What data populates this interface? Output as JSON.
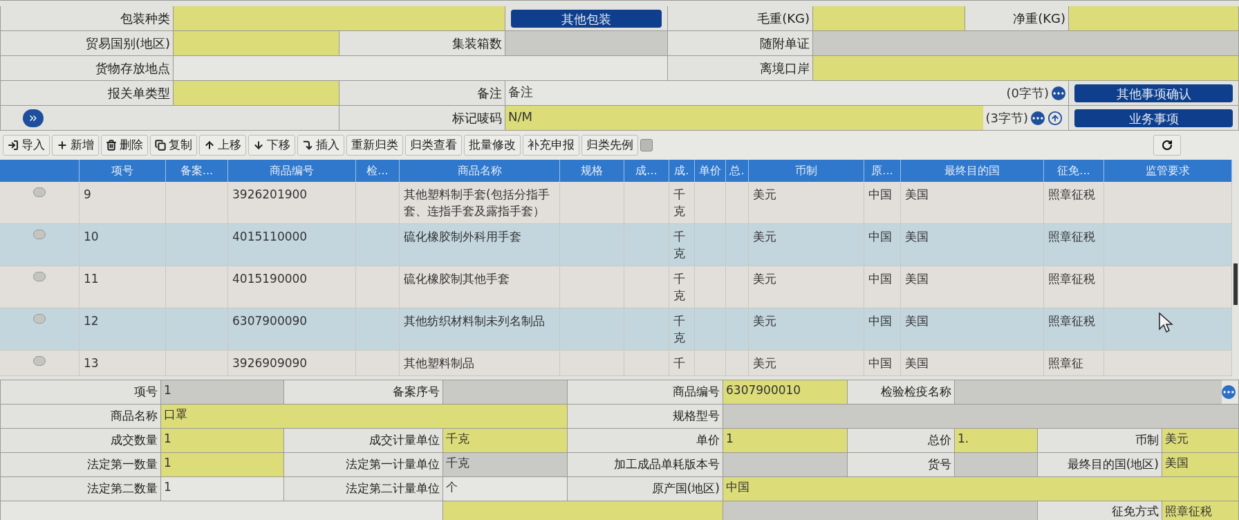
{
  "header_form": {
    "rows": [
      [
        {
          "label": "包装种类",
          "kind": "required_field"
        },
        {
          "kind": "button",
          "text": "其他包装"
        },
        {
          "label": "毛重(KG)",
          "kind": "required_field"
        },
        {
          "label": "净重(KG)",
          "kind": "required_field"
        }
      ],
      [
        {
          "label": "贸易国别(地区)",
          "kind": "required_field"
        },
        {
          "label": "集装箱数",
          "kind": "readonly_field"
        },
        {
          "label": "随附单证",
          "kind": "readonly_field"
        }
      ],
      [
        {
          "label": "货物存放地点",
          "kind": "field"
        },
        {
          "label": "离境口岸",
          "kind": "required_field"
        }
      ],
      [
        {
          "label": "报关单类型",
          "kind": "required_field"
        },
        {
          "label": "备注",
          "kind": "field",
          "value": "备注",
          "counter": "(0字节)"
        },
        {
          "kind": "button",
          "text": "其他事项确认"
        }
      ],
      [
        {
          "kind": "expand"
        },
        {
          "label": "标记唛码",
          "kind": "required_field",
          "value": "N/M",
          "counter": "(3字节)"
        },
        {
          "kind": "button",
          "text": "业务事项"
        }
      ]
    ]
  },
  "toolbar": {
    "buttons": [
      {
        "label": "导入"
      },
      {
        "label": "新增"
      },
      {
        "label": "删除"
      },
      {
        "label": "复制"
      },
      {
        "label": "上移"
      },
      {
        "label": "下移"
      },
      {
        "label": "插入"
      },
      {
        "label": "重新归类"
      },
      {
        "label": "归类查看"
      },
      {
        "label": "批量修改"
      },
      {
        "label": "补充申报"
      },
      {
        "label": "归类先例"
      }
    ],
    "toggle": {
      "checked": false
    }
  },
  "table": {
    "columns": [
      "项号",
      "备案...",
      "商品编号",
      "检...",
      "商品名称",
      "规格",
      "成...",
      "成.",
      "单价",
      "总.",
      "币制",
      "原...",
      "最终目的国",
      "征免...",
      "监管要求"
    ],
    "rows": [
      {
        "selected": false,
        "item_no": "9",
        "code": "3926201900",
        "name": "其他塑料制手套(包括分指手套、连指手套及露指手套）",
        "unit": "千克",
        "currency": "美元",
        "origin": "中国",
        "destination": "美国",
        "levy": "照章征税"
      },
      {
        "selected": false,
        "item_no": "10",
        "code": "4015110000",
        "name": "硫化橡胶制外科用手套",
        "unit": "千克",
        "currency": "美元",
        "origin": "中国",
        "destination": "美国",
        "levy": "照章征税"
      },
      {
        "selected": false,
        "item_no": "11",
        "code": "4015190000",
        "name": "硫化橡胶制其他手套",
        "unit": "千克",
        "currency": "美元",
        "origin": "中国",
        "destination": "美国",
        "levy": "照章征税"
      },
      {
        "selected": false,
        "item_no": "12",
        "code": "6307900090",
        "name": "其他纺织材料制未列名制品",
        "unit": "千克",
        "currency": "美元",
        "origin": "中国",
        "destination": "美国",
        "levy": "照章征税"
      },
      {
        "selected": false,
        "item_no": "13",
        "code": "3926909090",
        "name": "其他塑料制品",
        "unit": "千",
        "currency": "美元",
        "origin": "中国",
        "destination": "美国",
        "levy": "照章征"
      }
    ]
  },
  "item_form": {
    "fields": [
      {
        "label": "项号",
        "kind": "readonly_field",
        "value": "1"
      },
      {
        "label": "备案序号",
        "kind": "readonly_field"
      },
      {
        "label": "商品编号",
        "kind": "required_field",
        "value": "6307900010"
      },
      {
        "label": "检验检疫名称",
        "kind": "lookup_field"
      },
      {
        "label": "商品名称",
        "kind": "required_field",
        "value": "口罩"
      },
      {
        "label": "规格型号",
        "kind": "readonly_field"
      },
      {
        "label": "成交数量",
        "kind": "required_field",
        "value": "1"
      },
      {
        "label": "成交计量单位",
        "kind": "required_field",
        "value": "千克"
      },
      {
        "label": "单价",
        "kind": "required_field",
        "value": "1"
      },
      {
        "label": "总价",
        "kind": "required_field",
        "value": "1."
      },
      {
        "label": "币制",
        "kind": "required_field",
        "value": "美元"
      },
      {
        "label": "法定第一数量",
        "kind": "required_field",
        "value": "1"
      },
      {
        "label": "法定第一计量单位",
        "kind": "readonly_field",
        "value": "千克"
      },
      {
        "label": "加工成品单耗版本号",
        "kind": "readonly_field"
      },
      {
        "label": "货号",
        "kind": "readonly_field"
      },
      {
        "label": "最终目的国(地区)",
        "kind": "required_field",
        "value": "美国"
      },
      {
        "label": "法定第二数量",
        "kind": "field",
        "value": "1"
      },
      {
        "label": "法定第二计量单位",
        "kind": "field",
        "value": "个"
      },
      {
        "label": "原产国(地区)",
        "kind": "required_field",
        "value": "中国"
      },
      {
        "kind": "field"
      },
      {
        "kind": "required_field"
      },
      {
        "kind": "readonly_field"
      },
      {
        "label": "征免方式",
        "kind": "required_field",
        "value": "照章征税"
      }
    ]
  }
}
